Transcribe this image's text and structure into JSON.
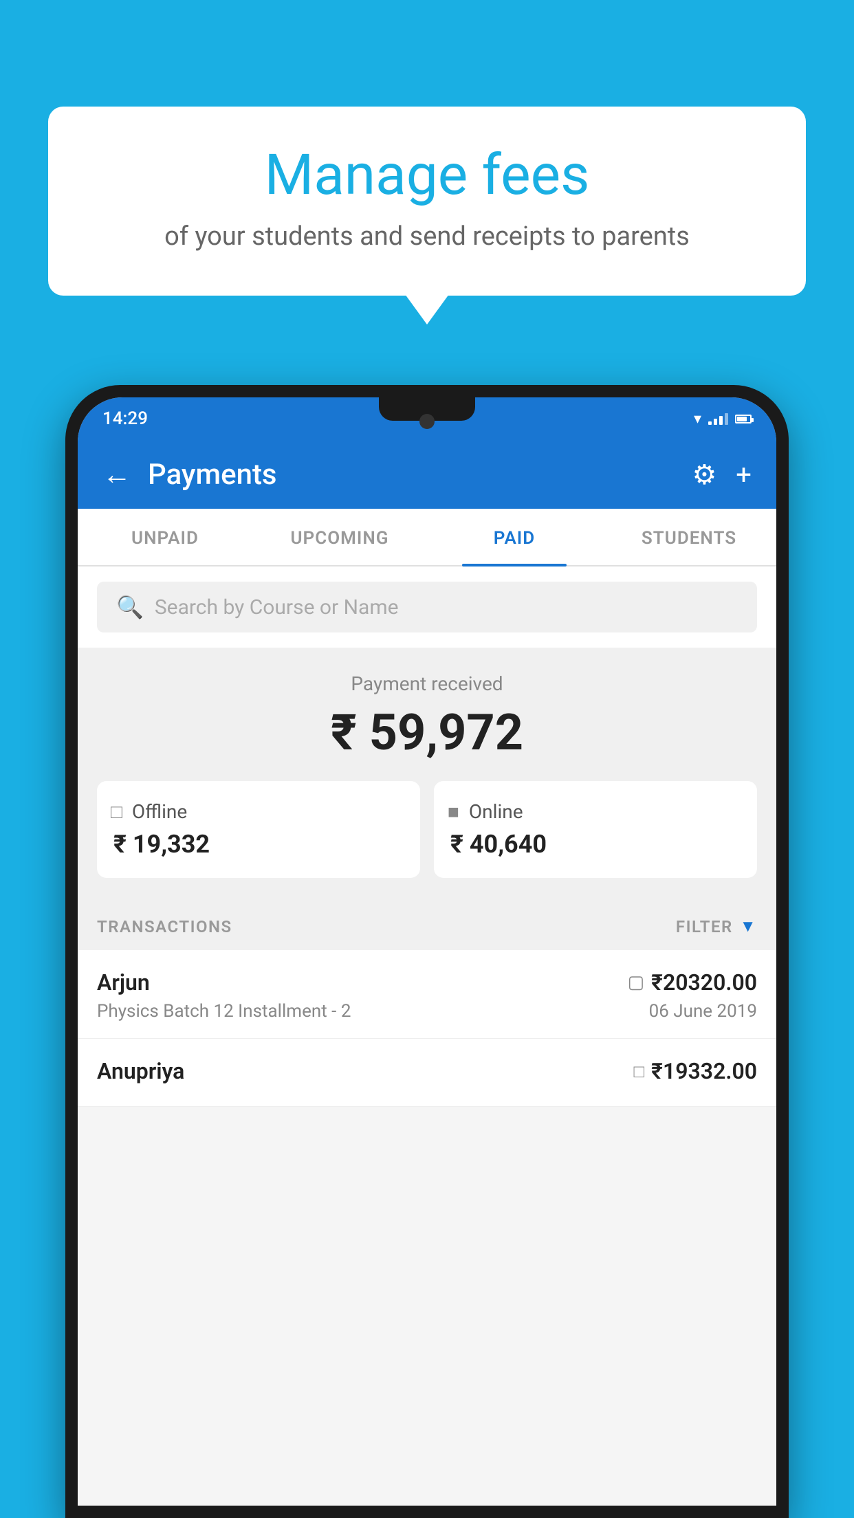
{
  "background_color": "#1AAFE3",
  "bubble": {
    "title": "Manage fees",
    "subtitle": "of your students and send receipts to parents"
  },
  "status_bar": {
    "time": "14:29"
  },
  "app_bar": {
    "title": "Payments"
  },
  "tabs": [
    {
      "id": "unpaid",
      "label": "UNPAID",
      "active": false
    },
    {
      "id": "upcoming",
      "label": "UPCOMING",
      "active": false
    },
    {
      "id": "paid",
      "label": "PAID",
      "active": true
    },
    {
      "id": "students",
      "label": "STUDENTS",
      "active": false
    }
  ],
  "search": {
    "placeholder": "Search by Course or Name"
  },
  "payment_summary": {
    "label": "Payment received",
    "total": "₹ 59,972",
    "offline": {
      "label": "Offline",
      "amount": "₹ 19,332"
    },
    "online": {
      "label": "Online",
      "amount": "₹ 40,640"
    }
  },
  "transactions": {
    "header_label": "TRANSACTIONS",
    "filter_label": "FILTER",
    "rows": [
      {
        "name": "Arjun",
        "course": "Physics Batch 12 Installment - 2",
        "amount": "₹20320.00",
        "date": "06 June 2019",
        "type": "online"
      },
      {
        "name": "Anupriya",
        "course": "",
        "amount": "₹19332.00",
        "date": "",
        "type": "offline"
      }
    ]
  }
}
